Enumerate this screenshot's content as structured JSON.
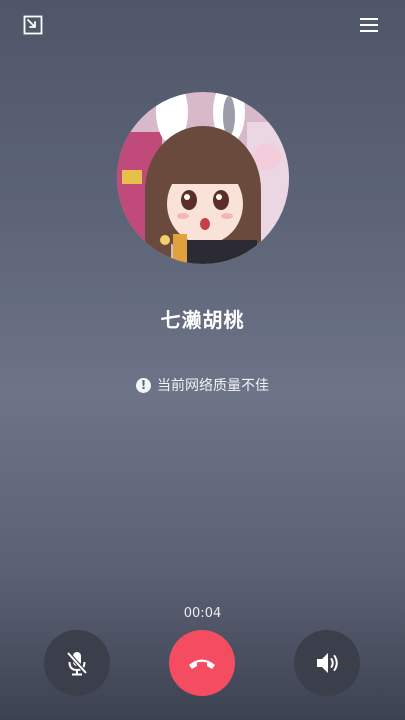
{
  "top_bar": {
    "minimize_icon": "minimize-window-icon",
    "menu_icon": "menu-icon"
  },
  "caller": {
    "name": "七濑胡桃",
    "avatar_icon": "anime-girl-avatar"
  },
  "network": {
    "warning_text": "当前网络质量不佳",
    "warning_glyph": "!"
  },
  "call": {
    "duration": "00:04"
  },
  "controls": {
    "mute_icon": "microphone-muted-icon",
    "hangup_icon": "phone-hangup-icon",
    "speaker_icon": "speaker-icon"
  },
  "colors": {
    "hangup": "#f44d62",
    "control_bg": "#3b3f4b",
    "background_top": "#4f5668",
    "background_bottom": "#3d4252"
  }
}
